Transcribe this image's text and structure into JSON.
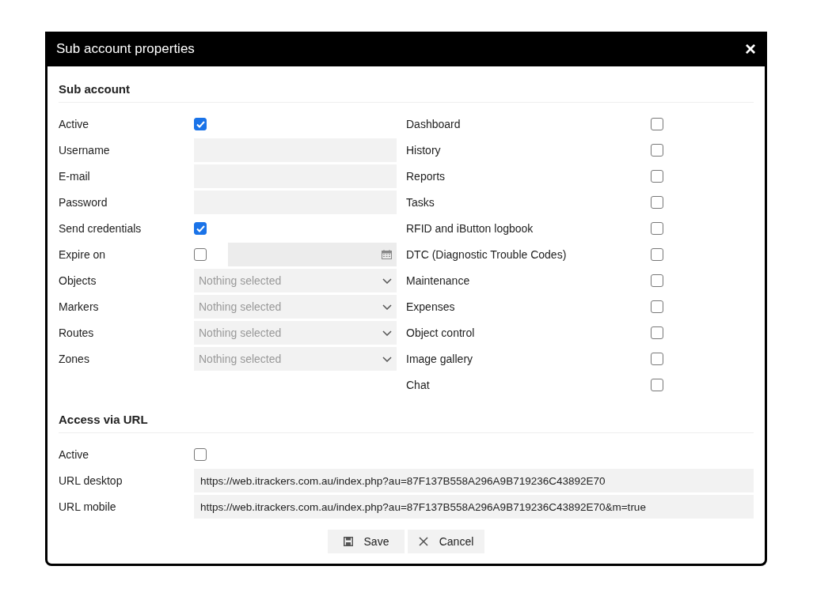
{
  "window": {
    "title": "Sub account properties",
    "close": "×"
  },
  "sub_account": {
    "title": "Sub account",
    "fields": [
      {
        "kind": "checkbox",
        "label": "Active",
        "checked": true
      },
      {
        "kind": "text",
        "label": "Username"
      },
      {
        "kind": "text",
        "label": "E-mail"
      },
      {
        "kind": "text",
        "label": "Password"
      },
      {
        "kind": "checkbox",
        "label": "Send credentials",
        "checked": true
      },
      {
        "kind": "date",
        "label": "Expire on",
        "checked": false
      },
      {
        "kind": "select",
        "label": "Objects",
        "placeholder": "Nothing selected"
      },
      {
        "kind": "select",
        "label": "Markers",
        "placeholder": "Nothing selected"
      },
      {
        "kind": "select",
        "label": "Routes",
        "placeholder": "Nothing selected"
      },
      {
        "kind": "select",
        "label": "Zones",
        "placeholder": "Nothing selected"
      }
    ],
    "permissions": [
      {
        "label": "Dashboard",
        "checked": false
      },
      {
        "label": "History",
        "checked": false
      },
      {
        "label": "Reports",
        "checked": false
      },
      {
        "label": "Tasks",
        "checked": false
      },
      {
        "label": "RFID and iButton logbook",
        "checked": false
      },
      {
        "label": "DTC (Diagnostic Trouble Codes)",
        "checked": false
      },
      {
        "label": "Maintenance",
        "checked": false
      },
      {
        "label": "Expenses",
        "checked": false
      },
      {
        "label": "Object control",
        "checked": false
      },
      {
        "label": "Image gallery",
        "checked": false
      },
      {
        "label": "Chat",
        "checked": false
      }
    ]
  },
  "access_via_url": {
    "title": "Access via URL",
    "fields": [
      {
        "kind": "checkbox",
        "label": "Active",
        "checked": false
      },
      {
        "kind": "url",
        "label": "URL desktop",
        "value": "https://web.itrackers.com.au/index.php?au=87F137B558A296A9B719236C43892E70"
      },
      {
        "kind": "url",
        "label": "URL mobile",
        "value": "https://web.itrackers.com.au/index.php?au=87F137B558A296A9B719236C43892E70&m=true"
      }
    ]
  },
  "buttons": [
    {
      "kind": "save",
      "label": "Save"
    },
    {
      "kind": "cancel",
      "label": "Cancel"
    }
  ]
}
